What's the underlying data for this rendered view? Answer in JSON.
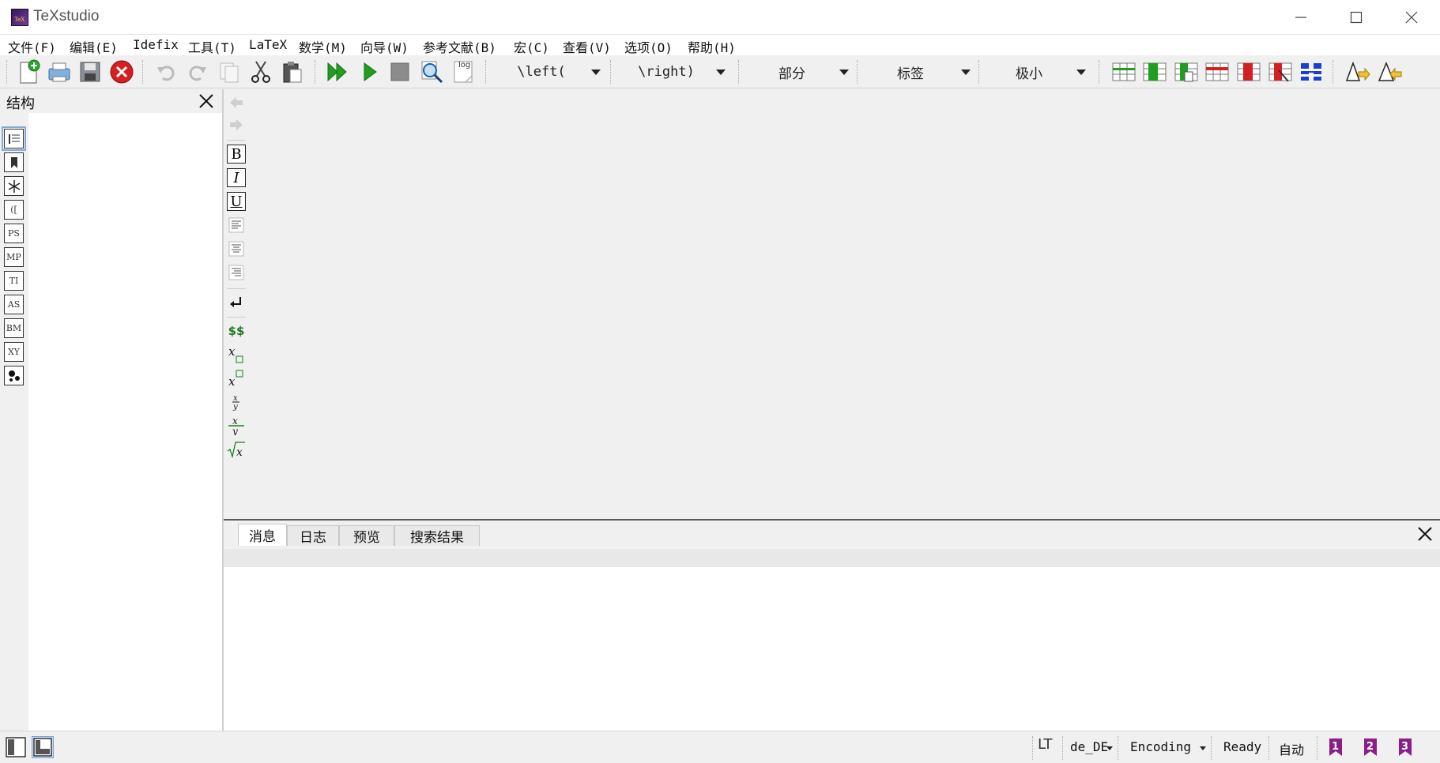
{
  "window": {
    "title": "TeXstudio",
    "app_icon_text": "TeX"
  },
  "menu": [
    {
      "label": "文件(F)"
    },
    {
      "label": "编辑(E)"
    },
    {
      "label": "Idefix"
    },
    {
      "label": "工具(T)"
    },
    {
      "label": "LaTeX"
    },
    {
      "label": "数学(M)"
    },
    {
      "label": "向导(W)"
    },
    {
      "label": "参考文献(B)"
    },
    {
      "label": "宏(C)"
    },
    {
      "label": "查看(V)"
    },
    {
      "label": "选项(O)"
    },
    {
      "label": "帮助(H)"
    }
  ],
  "toolbar": {
    "icons": [
      "new-file-icon",
      "print-icon",
      "save-icon",
      "close-document-icon",
      "undo-icon",
      "redo-icon",
      "copy-icon",
      "cut-icon",
      "paste-icon",
      "build-view-icon",
      "compile-icon",
      "stop-icon",
      "view-icon",
      "log-icon"
    ],
    "log_label": "log",
    "left_delim": "\\left(",
    "right_delim": "\\right)",
    "section": "部分",
    "label": "标签",
    "size": "极小",
    "table_icons": [
      "add-row-icon",
      "add-column-icon",
      "insert-column-icon",
      "remove-row-icon",
      "remove-column-icon",
      "cut-column-icon",
      "align-columns-icon",
      "warning-next-icon",
      "warning-prev-icon"
    ]
  },
  "structure": {
    "title": "结构",
    "side_icons": [
      {
        "name": "structure-icon",
        "text": ""
      },
      {
        "name": "bookmarks-icon",
        "text": ""
      },
      {
        "name": "symbols-icon",
        "text": ""
      },
      {
        "name": "delimiters-icon",
        "text": "(["
      },
      {
        "name": "pstricks-icon",
        "text": "PS"
      },
      {
        "name": "metapost-icon",
        "text": "MP"
      },
      {
        "name": "tikz-icon",
        "text": "TI"
      },
      {
        "name": "asymptote-icon",
        "text": "AS"
      },
      {
        "name": "beamer-icon",
        "text": "BM"
      },
      {
        "name": "xymatrix-icon",
        "text": "XY"
      },
      {
        "name": "special-icon",
        "text": ""
      }
    ]
  },
  "format": {
    "bold": "B",
    "italic": "I",
    "underline": "U",
    "math": "$$"
  },
  "messages": {
    "tabs": [
      "消息",
      "日志",
      "预览",
      "搜索结果"
    ]
  },
  "status": {
    "lt": "LT",
    "language": "de_DE",
    "encoding": "Encoding",
    "ready": "Ready",
    "auto": "自动"
  },
  "colors": {
    "accent_green": "#1f9e1f",
    "accent_red": "#d42020",
    "accent_blue": "#1a3fd4",
    "bookmark_purple": "#8a1f8a"
  }
}
